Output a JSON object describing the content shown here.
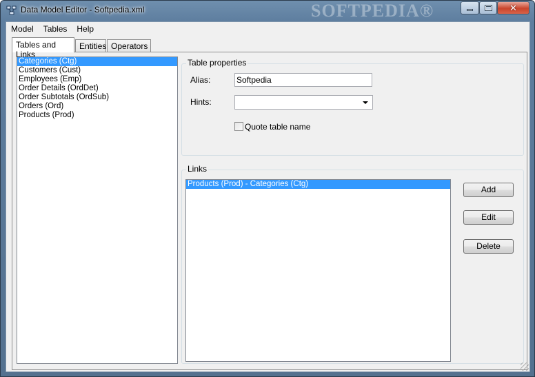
{
  "window": {
    "title": "Data Model Editor - Softpedia.xml",
    "watermark": "SOFTPEDIA®",
    "app_icon": "data-model-icon"
  },
  "menu": [
    "Model",
    "Tables",
    "Help"
  ],
  "tabs": [
    "Tables and Links",
    "Entities",
    "Operators"
  ],
  "active_tab": "Tables and Links",
  "tables": [
    "Categories (Ctg)",
    "Customers (Cust)",
    "Employees (Emp)",
    "Order Details (OrdDet)",
    "Order Subtotals (OrdSub)",
    "Orders (Ord)",
    "Products (Prod)"
  ],
  "selected_table": "Categories (Ctg)",
  "table_properties": {
    "title": "Table properties",
    "alias_label": "Alias:",
    "alias_value": "Softpedia",
    "hints_label": "Hints:",
    "hints_value": "",
    "quote_label": "Quote table name",
    "quote_checked": false
  },
  "links": {
    "title": "Links",
    "items": [
      "Products (Prod) - Categories (Ctg)"
    ],
    "selected": "Products (Prod) - Categories (Ctg)",
    "add_label": "Add",
    "edit_label": "Edit",
    "delete_label": "Delete"
  },
  "colors": {
    "selection": "#3399ff",
    "window_frame": "#5e7e9f",
    "close_button": "#c9452c"
  }
}
